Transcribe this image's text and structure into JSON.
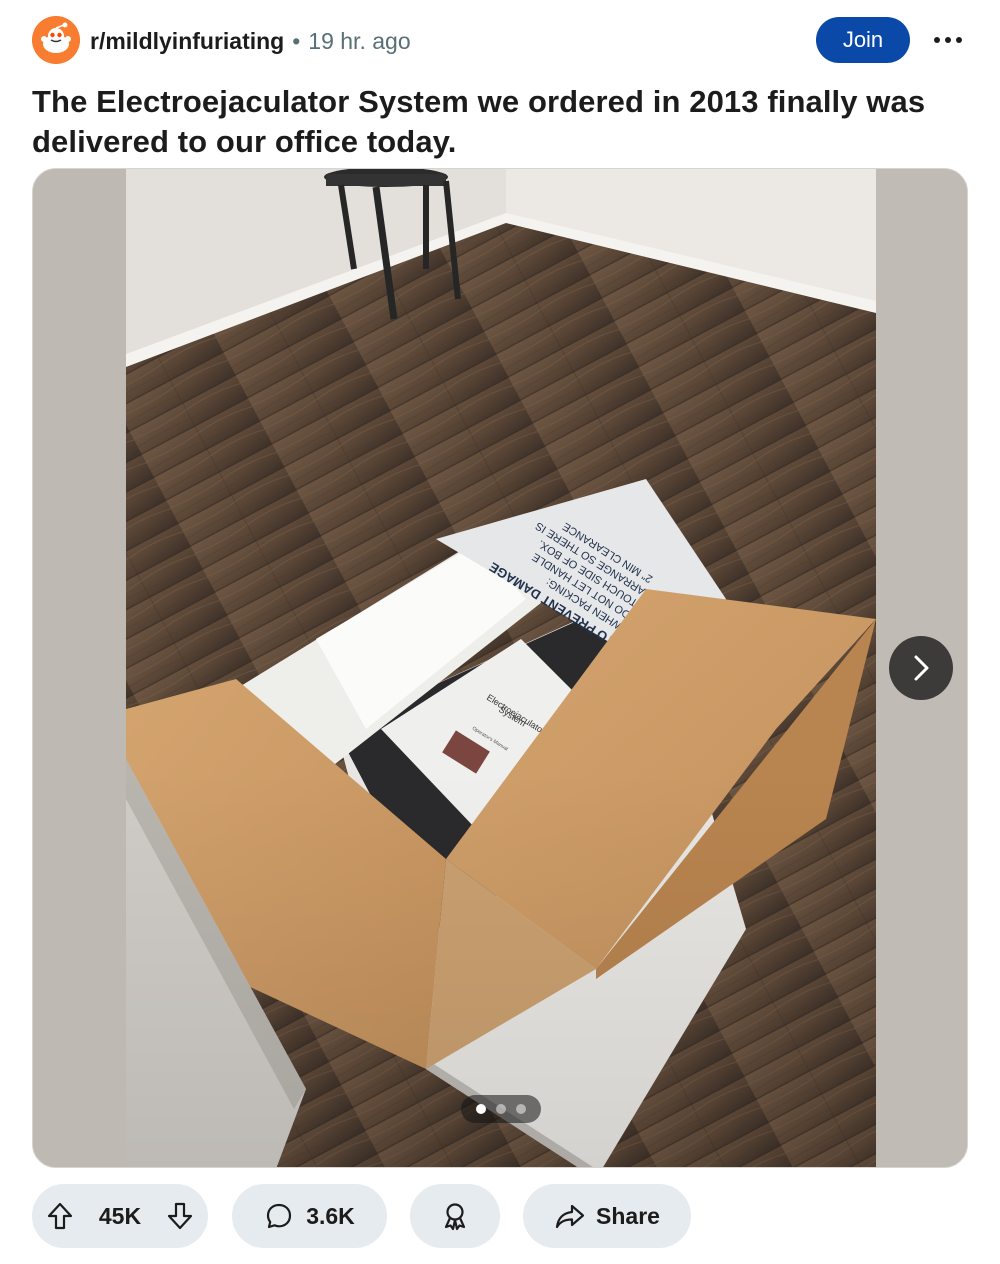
{
  "post": {
    "subreddit": "r/mildlyinfuriating",
    "separator": "•",
    "time_ago": "19 hr. ago",
    "join_label": "Join",
    "more_label": "•••",
    "title": "The Electroejaculator System we ordered in 2013 finally was delivered to our office today."
  },
  "media": {
    "box_flap_text": [
      "TO PREVENT DAMAGE",
      "WHEN PACKING:",
      "DO NOT LET HANDLE",
      "TOUCH SIDE OF BOX.",
      "ARRANGE SO THERE IS",
      "2\" MIN CLEARANCE"
    ],
    "manual_title": [
      "Electroejaculator",
      "System"
    ],
    "manual_subtitle": "Operator's Manual",
    "page_count": 3,
    "current_page": 1
  },
  "actions": {
    "upvotes": "45K",
    "comments": "3.6K",
    "share_label": "Share"
  },
  "colors": {
    "join": "#0b49a8",
    "pill": "#e5ebee",
    "subreddit_icon": "#f97d31"
  },
  "icons": [
    "snoo-icon",
    "more-icon",
    "chevron-right-icon",
    "upvote-icon",
    "downvote-icon",
    "comment-icon",
    "award-icon",
    "share-icon"
  ]
}
